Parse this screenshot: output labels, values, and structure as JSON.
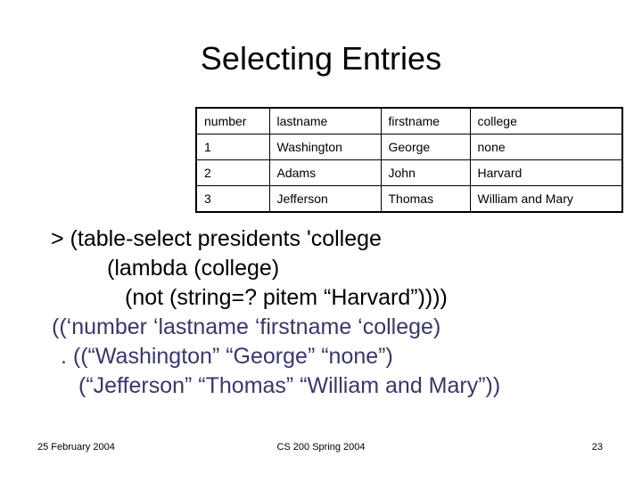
{
  "slide": {
    "title": "Selecting Entries"
  },
  "table": {
    "headers": [
      "number",
      "lastname",
      "firstname",
      "college"
    ],
    "rows": [
      [
        "1",
        "Washington",
        "George",
        "none"
      ],
      [
        "2",
        "Adams",
        "John",
        "Harvard"
      ],
      [
        "3",
        "Jefferson",
        "Thomas",
        "William and Mary"
      ]
    ]
  },
  "code": {
    "input_color": "#000000",
    "output_color": "#373771",
    "lines": [
      {
        "text": "> (table-select presidents 'college",
        "color": "input",
        "indent": 0
      },
      {
        "text": "(lambda (college)",
        "color": "input",
        "indent": 1
      },
      {
        "text": "(not (string=? pitem “Harvard”))))",
        "color": "input",
        "indent": 2
      },
      {
        "text": "((‘number ‘lastname ‘firstname ‘college)",
        "color": "output",
        "indent": 0
      },
      {
        "text": ". ((“Washington” “George” “none”)",
        "color": "output",
        "indent": 1
      },
      {
        "text": "(“Jefferson” “Thomas” “William and Mary”))",
        "color": "output",
        "indent": 2
      }
    ]
  },
  "footer": {
    "date": "25 February 2004",
    "course": "CS 200 Spring 2004",
    "page_number": "23"
  }
}
